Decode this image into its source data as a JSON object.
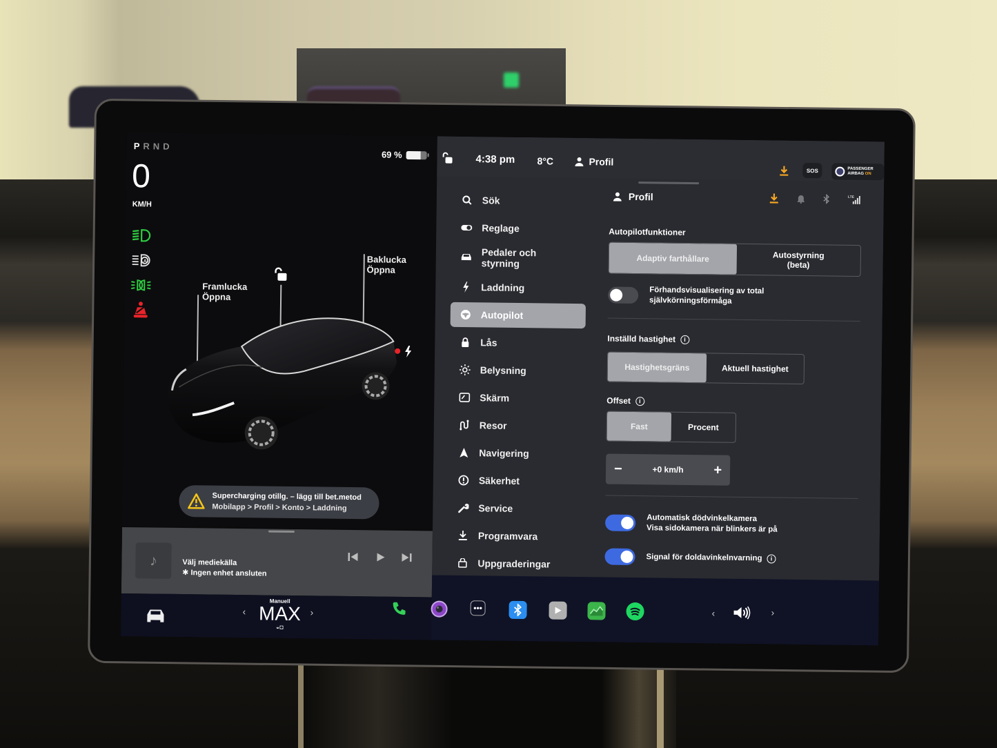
{
  "car_panel": {
    "gear": {
      "selected": "P",
      "others": "RND"
    },
    "speed": "0",
    "speed_unit": "KM/H",
    "battery": {
      "label": "69 %",
      "level_percent": 69
    },
    "telltales": [
      "low-beam-headlights-on",
      "auto-high-beam",
      "parking-lights-on",
      "seatbelt-warning"
    ],
    "frunk_label": {
      "title": "Framlucka",
      "action": "Öppna"
    },
    "trunk_label": {
      "title": "Baklucka",
      "action": "Öppna"
    },
    "notice": {
      "title": "Supercharging otillg. – lägg till bet.metod",
      "subtitle": "Mobilapp > Profil > Konto > Laddning"
    }
  },
  "media": {
    "title": "Välj mediekälla",
    "subtitle": "Ingen enhet ansluten",
    "controls": {
      "prev": "⏮",
      "play": "▶",
      "next": "⏭"
    }
  },
  "status_bar": {
    "time": "4:38 pm",
    "temperature": "8°C",
    "profile": "Profil",
    "sos": "SOS",
    "airbag_line1": "PASSENGER",
    "airbag_line2": "AIRBAG",
    "airbag_state": "ON"
  },
  "nav": {
    "items": [
      {
        "label": "Sök",
        "icon": "search-icon"
      },
      {
        "label": "Reglage",
        "icon": "toggle-icon"
      },
      {
        "label": "Pedaler och styrning",
        "icon": "car-icon"
      },
      {
        "label": "Laddning",
        "icon": "bolt-icon"
      },
      {
        "label": "Autopilot",
        "icon": "steering-wheel-icon",
        "active": true
      },
      {
        "label": "Lås",
        "icon": "lock-icon"
      },
      {
        "label": "Belysning",
        "icon": "sun-icon"
      },
      {
        "label": "Skärm",
        "icon": "display-icon"
      },
      {
        "label": "Resor",
        "icon": "trips-icon"
      },
      {
        "label": "Navigering",
        "icon": "navigation-icon"
      },
      {
        "label": "Säkerhet",
        "icon": "safety-icon"
      },
      {
        "label": "Service",
        "icon": "wrench-icon"
      },
      {
        "label": "Programvara",
        "icon": "download-icon"
      },
      {
        "label": "Uppgraderingar",
        "icon": "shopping-bag-icon"
      }
    ]
  },
  "content": {
    "header": "Profil",
    "autopilot_features": {
      "title": "Autopilotfunktioner",
      "options": [
        "Adaptiv farthållare",
        "Autostyrning (beta)"
      ],
      "selected": "Adaptiv farthållare"
    },
    "fsd_preview": {
      "label": "Förhandsvisualisering av total självkörningsförmåga",
      "enabled": false
    },
    "set_speed": {
      "title": "Inställd hastighet",
      "options": [
        "Hastighetsgräns",
        "Aktuell hastighet"
      ],
      "selected": "Hastighetsgräns"
    },
    "offset": {
      "title": "Offset",
      "options": [
        "Fast",
        "Procent"
      ],
      "selected": "Fast",
      "value": "+0 km/h",
      "minus": "−",
      "plus": "+"
    },
    "blind_spot_camera": {
      "title": "Automatisk dödvinkelkamera",
      "subtitle": "Visa sidokamera när blinkers är på",
      "enabled": true
    },
    "blind_spot_chime": {
      "title": "Signal för doldavinkelnvarning",
      "enabled": true
    }
  },
  "bottom_bar": {
    "climate_mode_label": "Manuell",
    "climate_mode_value": "MAX",
    "dock": [
      "phone",
      "camera",
      "more",
      "bluetooth",
      "theater",
      "stocks",
      "spotify"
    ],
    "volume_prev": "‹",
    "volume_next": "›"
  },
  "colors": {
    "accent_blue": "#3e6ae1",
    "warning_orange": "#f5a623",
    "telltale_green": "#2ecc40",
    "telltale_red": "#e8242a"
  }
}
